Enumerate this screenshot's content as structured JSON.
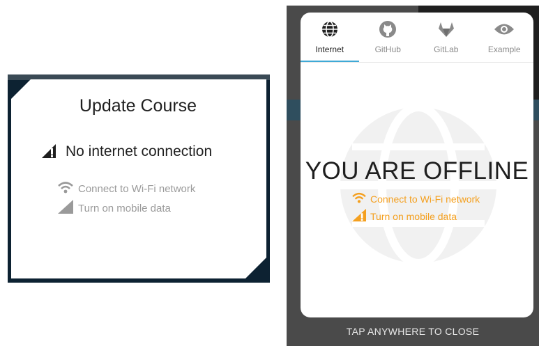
{
  "left_dialog": {
    "title": "Update Course",
    "status": "No internet connection",
    "options": [
      {
        "label": "Connect to Wi-Fi network",
        "icon": "wifi-icon"
      },
      {
        "label": "Turn on mobile data",
        "icon": "mobile-signal-icon"
      }
    ]
  },
  "right_dialog": {
    "tabs": [
      {
        "label": "Internet",
        "icon": "globe-icon",
        "active": true
      },
      {
        "label": "GitHub",
        "icon": "github-icon",
        "active": false
      },
      {
        "label": "GitLab",
        "icon": "gitlab-icon",
        "active": false
      },
      {
        "label": "Example",
        "icon": "eye-icon",
        "active": false
      }
    ],
    "headline": "YOU ARE OFFLINE",
    "options": [
      {
        "label": "Connect to Wi-Fi network",
        "icon": "wifi-icon"
      },
      {
        "label": "Turn on mobile data",
        "icon": "mobile-signal-icon"
      }
    ],
    "footer": "TAP ANYWHERE TO CLOSE"
  },
  "colors": {
    "accent_orange": "#f4a020",
    "tab_indicator": "#3fa9d6",
    "muted_gray": "#9a9a9a"
  }
}
